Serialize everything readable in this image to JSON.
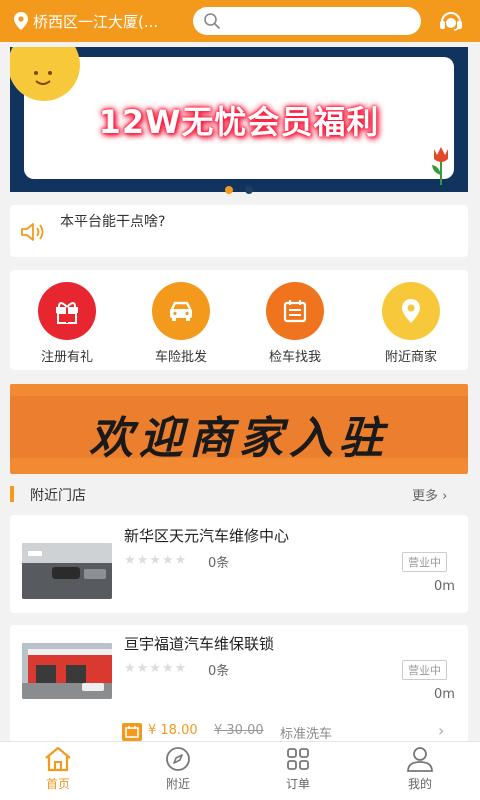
{
  "header": {
    "location": "桥西区一江大厦(...",
    "search_placeholder": ""
  },
  "banner": {
    "headline": "12W无忧会员福利",
    "slides": 2,
    "active_slide": 1
  },
  "notice": {
    "text": "本平台能干点啥?"
  },
  "quick_actions": [
    {
      "label": "注册有礼",
      "icon": "gift-icon",
      "color": "#e8262f"
    },
    {
      "label": "车险批发",
      "icon": "car-icon",
      "color": "#f39a1d"
    },
    {
      "label": "检车找我",
      "icon": "calendar-icon",
      "color": "#f0741e"
    },
    {
      "label": "附近商家",
      "icon": "location-pin-icon",
      "color": "#f7c93a"
    }
  ],
  "merchant_banner": {
    "text": "欢迎商家入驻"
  },
  "nearby": {
    "title": "附近门店",
    "more": "更多",
    "stores": [
      {
        "name": "新华区天元汽车维修中心",
        "stars": "★★★★★",
        "rating": 0,
        "reviews": "0条",
        "status": "营业中",
        "distance": "0m"
      },
      {
        "name": "亘宇福道汽车维保联锁",
        "stars": "★★★★★",
        "rating": 0,
        "reviews": "0条",
        "status": "营业中",
        "distance": "0m",
        "promo": {
          "price": "¥ 18.00",
          "original": "¥ 30.00",
          "service": "标准洗车"
        }
      }
    ]
  },
  "tabbar": {
    "tabs": [
      {
        "label": "首页",
        "icon": "home-icon",
        "active": true
      },
      {
        "label": "附近",
        "icon": "compass-icon",
        "active": false
      },
      {
        "label": "订单",
        "icon": "grid-icon",
        "active": false
      },
      {
        "label": "我的",
        "icon": "user-icon",
        "active": false
      }
    ]
  },
  "colors": {
    "brand": "#f39a1d",
    "banner_bg": "#10345e"
  }
}
